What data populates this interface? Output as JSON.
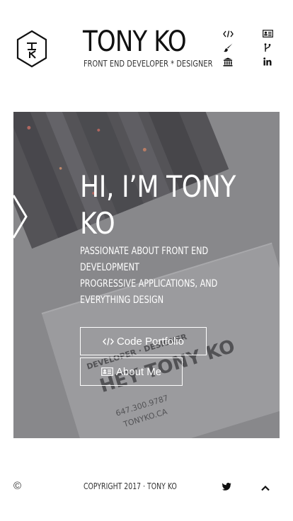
{
  "header": {
    "title": "TONY KO",
    "subtitle": "FRONT END DEVELOPER * DESIGNER",
    "logo_letters": "TK",
    "nav_icons": [
      "code-icon",
      "id-card-icon",
      "brush-icon",
      "git-branch-icon",
      "bank-icon",
      "linkedin-icon"
    ]
  },
  "hero": {
    "headline": "HI, I’M TONY KO",
    "lines": [
      "PASSIONATE ABOUT FRONT END",
      "DEVELOPMENT",
      "PROGRESSIVE APPLICATIONS, AND",
      "EVERYTHING DESIGN"
    ],
    "buttons": {
      "code_portfolio": "Code Portfolio",
      "about_me": "About Me"
    }
  },
  "footer": {
    "copyright_symbol": "©",
    "copyright_text": "COPYRIGHT 2017 · TONY KO",
    "icons": [
      "twitter-icon",
      "chevron-up-icon"
    ]
  },
  "colors": {
    "text": "#111111",
    "hero_overlay": "#8c8c8e",
    "button_border": "#ffffff"
  }
}
